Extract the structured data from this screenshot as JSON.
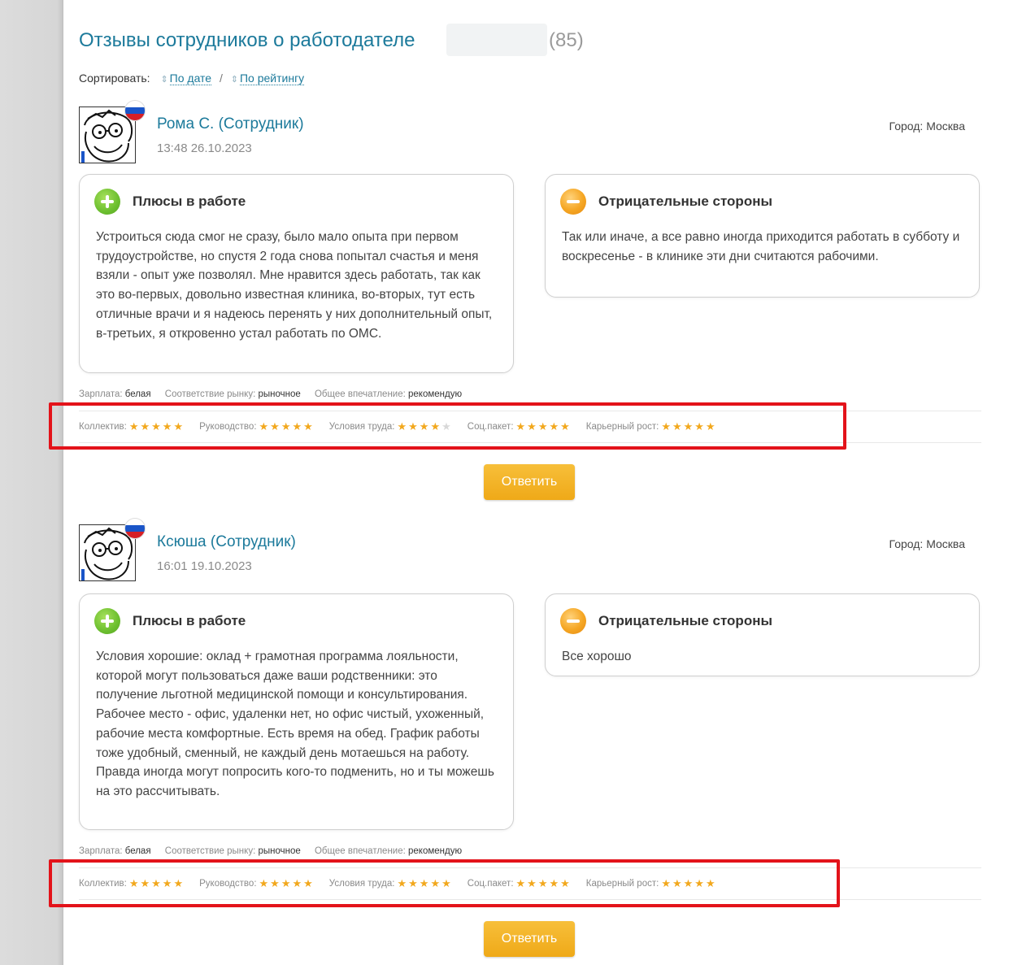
{
  "page": {
    "title": "Отзывы сотрудников о работодателе",
    "count": "(85)"
  },
  "sort": {
    "label": "Сортировать:",
    "by_date": "По дате",
    "separator": "/",
    "by_rating": "По рейтингу"
  },
  "labels": {
    "pros_title": "Плюсы в работе",
    "cons_title": "Отрицательные стороны",
    "salary": "Зарплата:",
    "market": "Соответствие рынку:",
    "impression": "Общее впечатление:",
    "team": "Коллектив:",
    "management": "Руководство:",
    "conditions": "Условия труда:",
    "social": "Соц.пакет:",
    "career": "Карьерный рост:",
    "reply": "Ответить"
  },
  "reviews": [
    {
      "author": "Рома С. (Сотрудник)",
      "date": "13:48 26.10.2023",
      "city": "Город: Москва",
      "pros": "Устроиться сюда смог не сразу, было мало опыта при первом трудоустройстве, но спустя 2 года снова попытал счастья и меня взяли - опыт уже позволял. Мне нравится здесь работать, так как это во-первых, довольно известная клиника, во-вторых, тут есть отличные врачи и я надеюсь перенять у них дополнительный опыт, в-третьих, я откровенно устал работать по ОМС.",
      "cons": "Так или иначе, а все равно иногда приходится работать в субботу и воскресенье - в клинике эти дни считаются рабочими.",
      "salary": "белая",
      "market": "рыночное",
      "impression": "рекомендую",
      "ratings": {
        "team": 5,
        "management": 5,
        "conditions": 4,
        "social": 5,
        "career": 5
      }
    },
    {
      "author": "Ксюша (Сотрудник)",
      "date": "16:01 19.10.2023",
      "city": "Город: Москва",
      "pros": "Условия хорошие: оклад + грамотная программа лояльности, которой могут пользоваться даже ваши родственники: это получение льготной медицинской помощи и консультирования. Рабочее место - офис, удаленки нет, но офис чистый, ухоженный, рабочие места комфортные. Есть время на обед. График работы тоже удобный, сменный, не каждый день мотаешься на работу. Правда иногда могут попросить кого-то подменить, но и ты можешь на это рассчитывать.",
      "cons": "Все хорошо",
      "salary": "белая",
      "market": "рыночное",
      "impression": "рекомендую",
      "ratings": {
        "team": 5,
        "management": 5,
        "conditions": 5,
        "social": 5,
        "career": 5
      }
    }
  ],
  "colors": {
    "link": "#1c7a9b",
    "star": "#f2a81d",
    "highlight": "#e3131a",
    "button": "#f2b125"
  }
}
